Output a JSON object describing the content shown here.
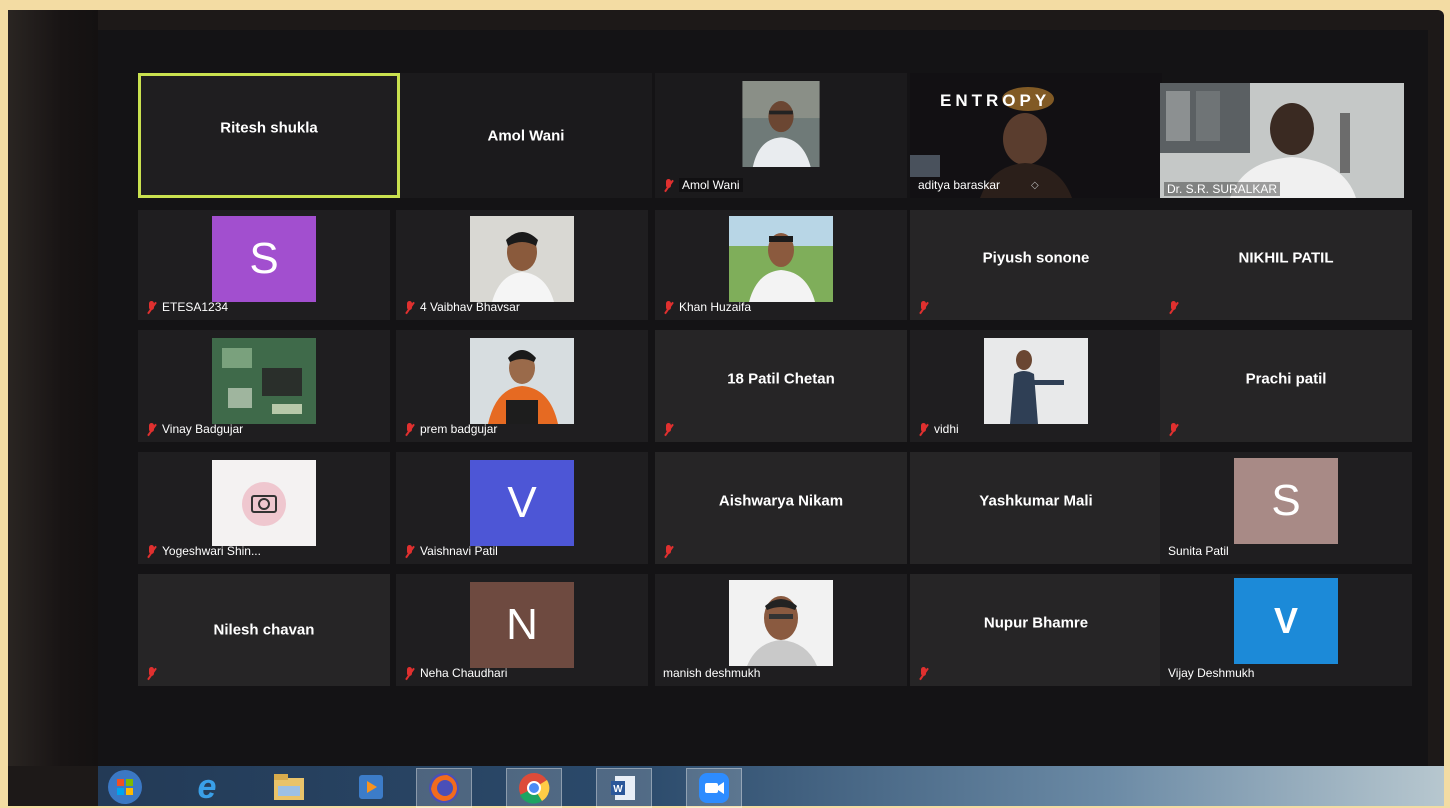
{
  "participants": [
    {
      "name": "Ritesh shukla"
    },
    {
      "name": "Amol Wani"
    },
    {
      "name": "Amol Wani"
    },
    {
      "name": "aditya baraskar",
      "logo_text": "ENTROPY"
    },
    {
      "name": "Dr. S.R. SURALKAR"
    },
    {
      "avatar_letter": "S",
      "name": "ETESA1234",
      "color": "#a24fcf"
    },
    {
      "name": "4 Vaibhav Bhavsar"
    },
    {
      "name": "Khan Huzaifa"
    },
    {
      "name": "Piyush sonone"
    },
    {
      "name": "NIKHIL PATIL"
    },
    {
      "name": "Vinay Badgujar"
    },
    {
      "name": "prem badgujar"
    },
    {
      "name": "18 Patil Chetan"
    },
    {
      "name": "vidhi"
    },
    {
      "name": "Prachi patil"
    },
    {
      "name": "Yogeshwari Shin..."
    },
    {
      "avatar_letter": "V",
      "name": "Vaishnavi Patil",
      "color": "#4d56d6"
    },
    {
      "name": "Aishwarya Nikam"
    },
    {
      "name": "Yashkumar Mali"
    },
    {
      "avatar_letter": "S",
      "name": "Sunita Patil",
      "color": "#a88a86"
    },
    {
      "name": "Nilesh chavan"
    },
    {
      "avatar_letter": "N",
      "name": "Neha Chaudhari",
      "color": "#6e4a40"
    },
    {
      "name": "manish deshmukh"
    },
    {
      "name": "Nupur Bhamre"
    },
    {
      "avatar_letter": "V",
      "name": "Vijay Deshmukh",
      "color": "#1c8ad8"
    }
  ],
  "colors": {
    "active_border": "#c9e14f",
    "muted_mic": "#e0302f",
    "tile_bg": "#262526"
  },
  "taskbar": [
    {
      "icon": "windows-start-icon"
    },
    {
      "icon": "internet-explorer-icon"
    },
    {
      "icon": "file-explorer-icon"
    },
    {
      "icon": "media-player-icon"
    },
    {
      "icon": "firefox-icon"
    },
    {
      "icon": "chrome-icon"
    },
    {
      "icon": "word-icon"
    },
    {
      "icon": "zoom-icon"
    }
  ]
}
